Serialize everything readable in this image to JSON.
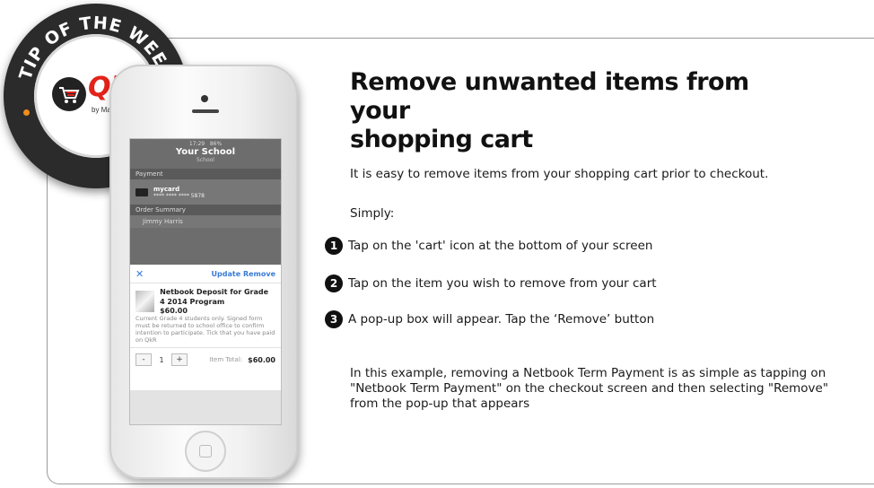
{
  "badge": {
    "ring_text": "TIP OF THE WEEK",
    "logo_word": "Qkr!",
    "logo_sub": "by MasterCard",
    "accent_color": "#e2231a",
    "dot_color": "#f28c1a"
  },
  "phone_screen": {
    "status_time": "17:29",
    "status_battery": "86%",
    "school_name": "Your School",
    "school_sub": "School",
    "payment_section": "Payment",
    "card_name": "mycard",
    "card_number": "**** **** **** 5878",
    "order_section": "Order Summary",
    "person_name": "Jimmy Harris",
    "popup": {
      "close_icon": "close-icon",
      "update_label": "Update",
      "remove_label": "Remove",
      "item_name": "Netbook Deposit for Grade 4 2014 Program",
      "item_price": "$60.00",
      "item_description": "Current Grade 4 students only. Signed form must be returned to school office to confirm intention to participate. Tick that you have paid on QkR",
      "qty_minus": "-",
      "qty_value": "1",
      "qty_plus": "+",
      "item_total_label": "Item Total:",
      "item_total_value": "$60.00"
    }
  },
  "content": {
    "headline_line1": "Remove unwanted items from your",
    "headline_line2": "shopping cart",
    "intro": "It is easy to remove items from your shopping cart prior to checkout.",
    "simply": "Simply:",
    "steps": [
      {
        "num": "1",
        "text": "Tap on the 'cart' icon at the bottom of your screen"
      },
      {
        "num": "2",
        "text": "Tap on the item you wish to remove from your cart"
      },
      {
        "num": "3",
        "text": "A pop-up box will appear. Tap the ‘Remove’ button"
      }
    ],
    "example": "In this example, removing a Netbook Term Payment is as simple as tapping on \"Netbook Term Payment\" on the checkout screen and then selecting \"Remove\" from the pop-up that appears"
  }
}
